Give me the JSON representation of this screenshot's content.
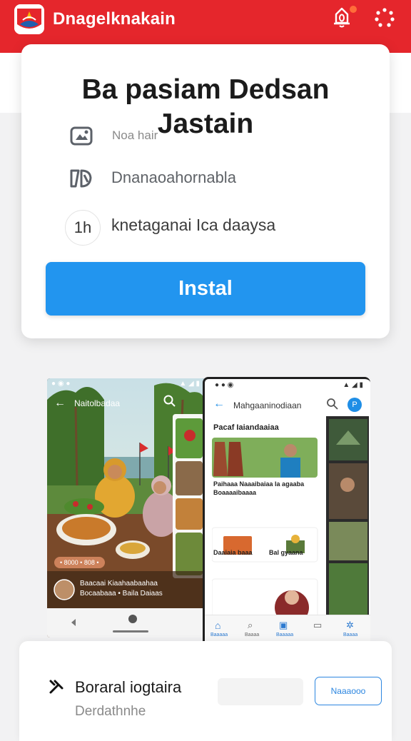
{
  "app": {
    "title": "Dnagelknakain",
    "notification_badge": true
  },
  "card": {
    "title_line1": "Ba pasiam Dedsan",
    "title_line2": "Jastain",
    "subtitle_fragment": "Noa hair",
    "features": [
      {
        "icon": "gallery-icon",
        "label": ""
      },
      {
        "icon": "quote-icon",
        "label": "Dnanaoahornabla"
      },
      {
        "icon": "hours-icon",
        "icon_text": "1h",
        "label": "knetaganai Ica daaysa"
      }
    ],
    "install_label": "Instal"
  },
  "screenshot_left": {
    "header_title": "Naitolbadaa",
    "tag": "• 8000 • 808 •",
    "caption_line1": "Baacaai Kiaahaabaahaa",
    "caption_line2": "Bocaabaaa • Baila Daiaas"
  },
  "screenshot_right": {
    "header_title": "Mahgaaninodiaan",
    "section_title": "Pacaf Iaiandaaiaa",
    "item1_line1": "Paihaaa Naaaibaiaa la agaaba",
    "item1_line2": "Boaaaaibaaaa",
    "item2_label_left": "Daaiaia baaa",
    "item2_label_right": "Bal gyaana",
    "nav": [
      "Baaaaa",
      "Baaaa",
      "Baaaaa",
      "",
      "Baaaa"
    ]
  },
  "bottom": {
    "title": "Boraral iogtaira",
    "subtitle": "Derdathnhe",
    "action_label": "Naaaooo"
  },
  "colors": {
    "brand_red": "#e5262c",
    "install_blue": "#2295ef",
    "accent_blue": "#1f8ee6"
  }
}
